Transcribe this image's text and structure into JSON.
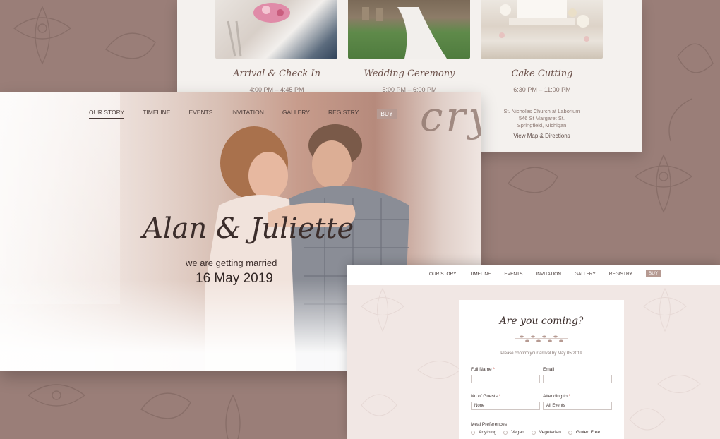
{
  "background": {
    "color": "#9a7e78"
  },
  "events": {
    "items": [
      {
        "title": "Arrival & Check In",
        "time": "4:00 PM – 4:45 PM"
      },
      {
        "title": "Wedding Ceremony",
        "time": "5:00 PM – 6:00 PM"
      },
      {
        "title": "Cake Cutting",
        "time": "6:30 PM – 11:00 PM"
      }
    ],
    "address": [
      "St. Nicholas Church at Laborium",
      "546 St Margaret St.",
      "Springfield, Michigan"
    ],
    "map_link": "View Map & Directions"
  },
  "hero": {
    "nav": [
      "OUR STORY",
      "TIMELINE",
      "EVENTS",
      "INVITATION",
      "GALLERY",
      "REGISTRY",
      "BUY"
    ],
    "active_nav": "OUR STORY",
    "names": "Alan & Juliette",
    "subtitle": "we are getting married",
    "date": "16 May 2019"
  },
  "rsvp": {
    "nav": [
      "OUR STORY",
      "TIMELINE",
      "EVENTS",
      "INVITATION",
      "GALLERY",
      "REGISTRY",
      "BUY"
    ],
    "active_nav": "INVITATION",
    "title": "Are you coming?",
    "hint": "Please confirm your arrival by May 05 2019",
    "fields": {
      "full_name": {
        "label": "Full Name",
        "required": "*",
        "value": ""
      },
      "email": {
        "label": "Email",
        "value": ""
      },
      "guests": {
        "label": "No of Guests",
        "required": "*",
        "value": "None"
      },
      "attending": {
        "label": "Attending to",
        "required": "*",
        "value": "All Events"
      }
    },
    "meal": {
      "label": "Meal Preferences",
      "options": [
        "Anything",
        "Vegan",
        "Vegetarian",
        "Gluten Free"
      ]
    }
  },
  "colors": {
    "accent": "#b69a92",
    "text": "#3b2d2b",
    "required": "#c0433c"
  }
}
